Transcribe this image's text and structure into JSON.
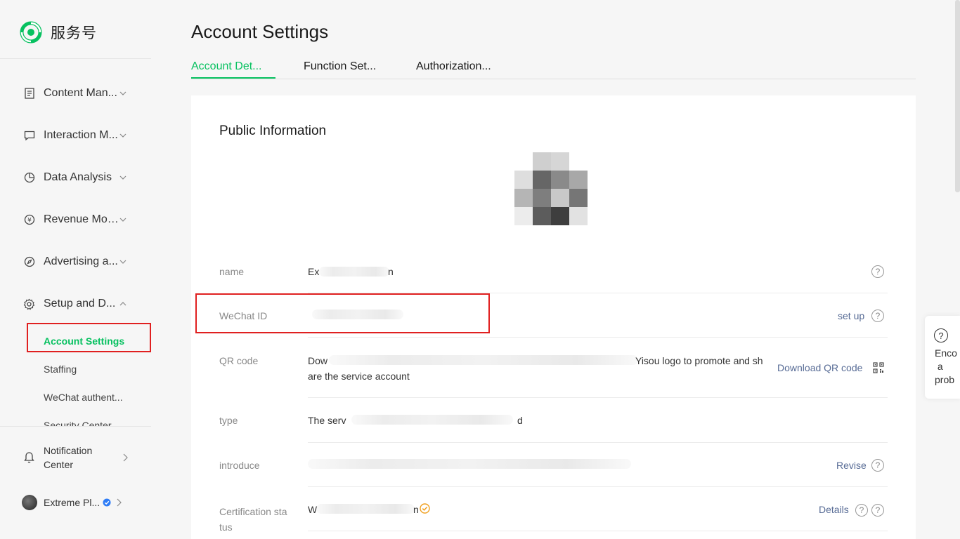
{
  "brand": {
    "name": "服务号"
  },
  "sidebar": {
    "items": [
      {
        "label": "Content Man...",
        "icon": "document-icon"
      },
      {
        "label": "Interaction M...",
        "icon": "chat-icon"
      },
      {
        "label": "Data Analysis",
        "icon": "pie-chart-icon"
      },
      {
        "label": "Revenue Mon...",
        "icon": "yen-icon"
      },
      {
        "label": "Advertising a...",
        "icon": "compass-icon"
      },
      {
        "label": "Setup and D...",
        "icon": "gear-icon"
      }
    ],
    "sub_items": [
      {
        "label": "Account Settings",
        "active": true
      },
      {
        "label": "Staffing"
      },
      {
        "label": "WeChat authent..."
      },
      {
        "label": "Security Center"
      }
    ],
    "notification": {
      "label_line1": "Notification",
      "label_line2": "Center"
    },
    "account": {
      "name": "Extreme Pl..."
    }
  },
  "page": {
    "title": "Account Settings"
  },
  "tabs": [
    {
      "label": "Account Det...",
      "active": true
    },
    {
      "label": "Function Set..."
    },
    {
      "label": "Authorization..."
    }
  ],
  "card": {
    "section_title": "Public Information",
    "rows": {
      "name": {
        "label": "name",
        "value_start": "Ex",
        "value_end": "n"
      },
      "wechat_id": {
        "label": "WeChat ID",
        "action": "set up"
      },
      "qr_code": {
        "label": "QR code",
        "value_start": "Dow",
        "value_mid": "Yisou logo to promote and sh",
        "value_line2": "are the service account",
        "action": "Download QR code"
      },
      "type": {
        "label": "type",
        "value_start": "The serv",
        "value_end": "d"
      },
      "introduce": {
        "label": "introduce",
        "action": "Revise"
      },
      "certification": {
        "label_line1": "Certification sta",
        "label_line2": "tus",
        "value_start": "W",
        "value_end": "n",
        "action": "Details"
      }
    }
  },
  "float_panel": {
    "text": "Enco\n a\nprob"
  },
  "colors": {
    "accent": "#07c160",
    "link": "#576b95",
    "highlight": "#e02020"
  }
}
